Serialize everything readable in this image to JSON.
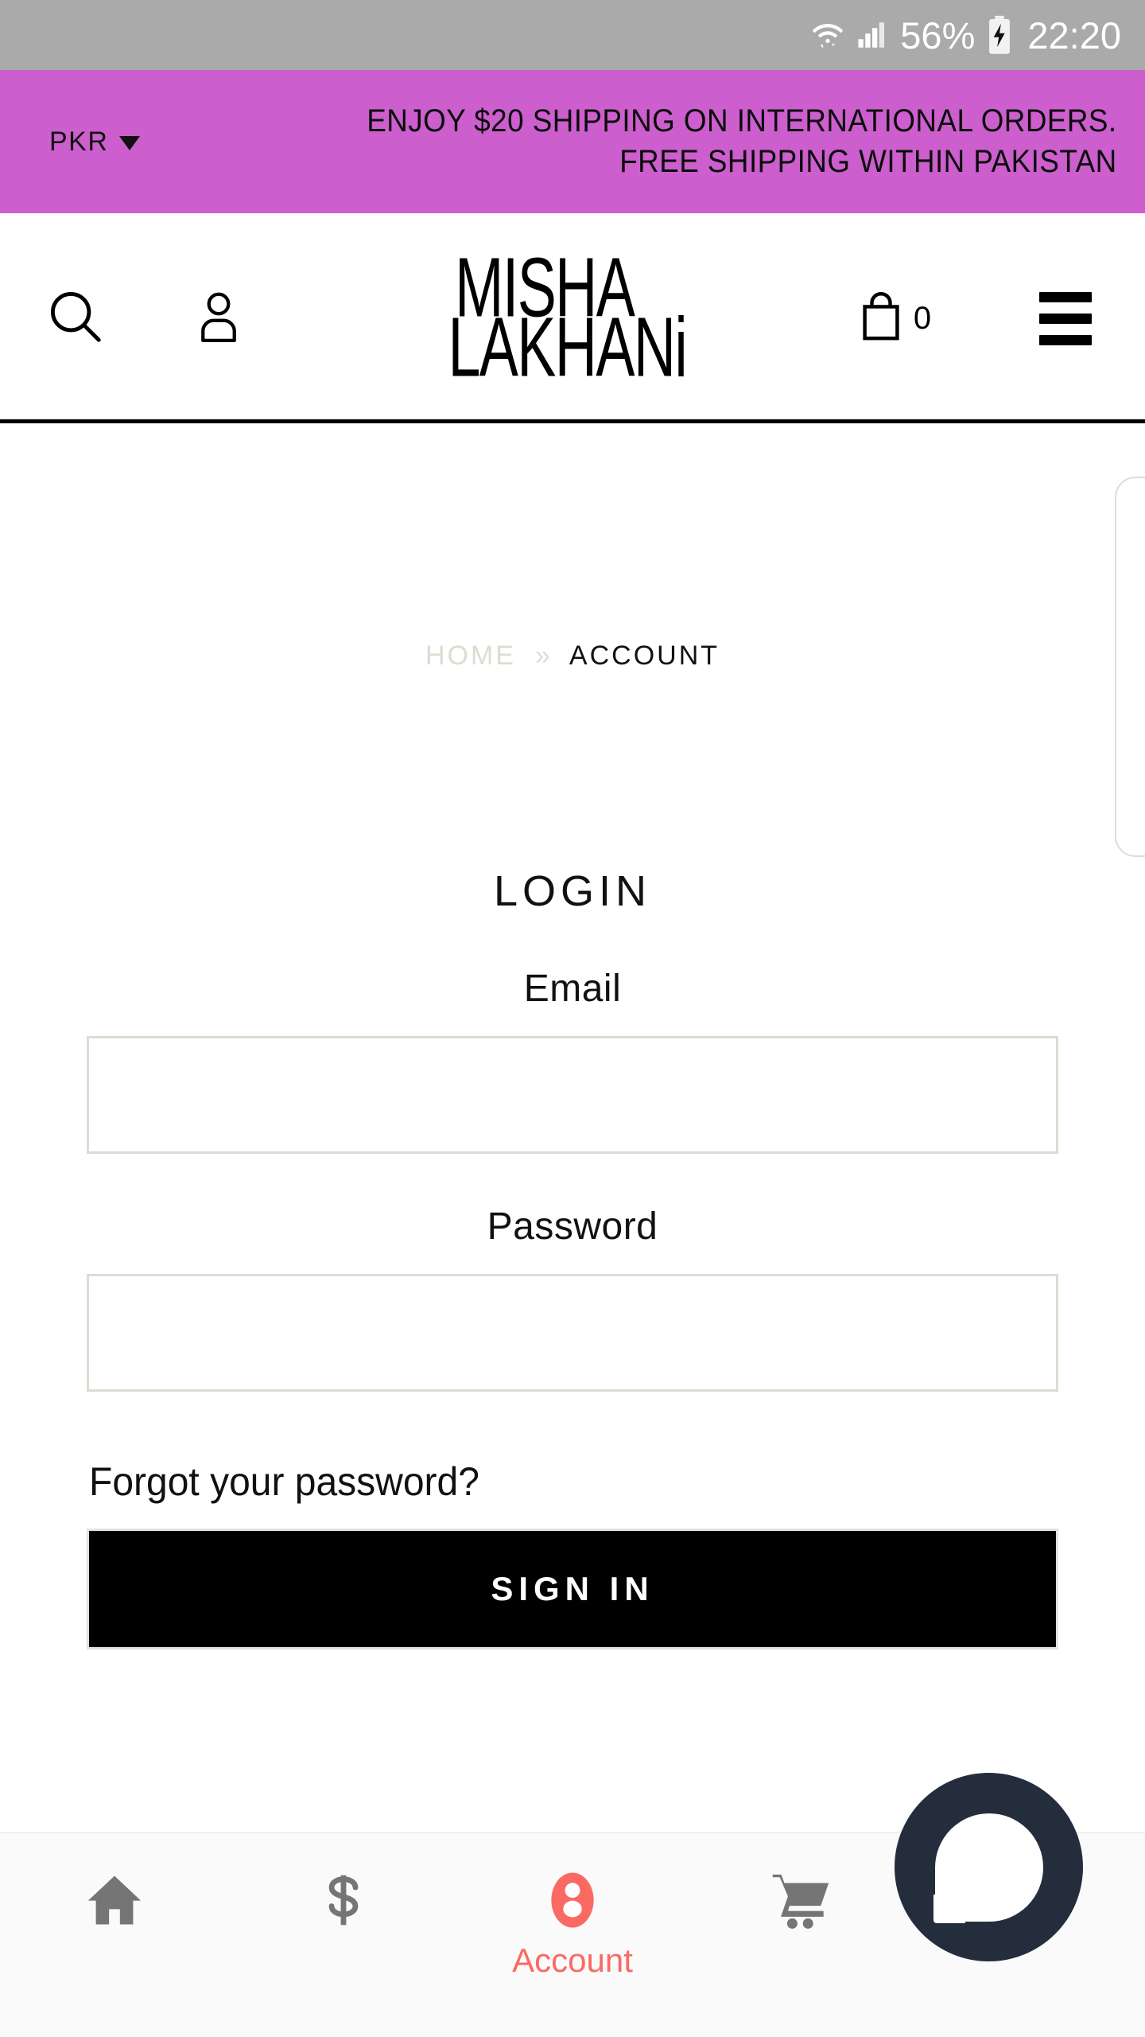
{
  "status_bar": {
    "battery_percent": "56%",
    "time": "22:20",
    "icons": [
      "wifi-icon",
      "cellular-signal-icon",
      "battery-charging-icon"
    ]
  },
  "promo_banner": {
    "currency": "PKR",
    "currency_caret": "caret-down-icon",
    "message": "ENJOY $20 SHIPPING ON INTERNATIONAL ORDERS.\nFREE SHIPPING WITHIN PAKISTAN",
    "background_color": "#cc5ecd"
  },
  "header": {
    "search_icon": "search-icon",
    "account_icon": "user-icon",
    "logo_line_1": "MISHA",
    "logo_line_2": "LAKHANi",
    "bag_icon": "shopping-bag-icon",
    "bag_count": "0",
    "menu_icon": "hamburger-menu-icon"
  },
  "breadcrumb": {
    "home": "HOME",
    "separator": "»",
    "current": "ACCOUNT"
  },
  "login_form": {
    "title": "LOGIN",
    "email_label": "Email",
    "email_value": "",
    "email_placeholder": "",
    "password_label": "Password",
    "password_value": "",
    "password_placeholder": "",
    "forgot_link": "Forgot your password?",
    "submit_label": "SIGN IN"
  },
  "chat_widget": {
    "icon": "chat-bubble-icon",
    "background_color": "#242d3c"
  },
  "bottom_nav": {
    "active_color": "#fa6a63",
    "inactive_color": "#757575",
    "items": [
      {
        "icon": "home-icon",
        "label": "",
        "active": false
      },
      {
        "icon": "dollar-icon",
        "label": "",
        "active": false
      },
      {
        "icon": "account-icon",
        "label": "Account",
        "active": true
      },
      {
        "icon": "cart-icon",
        "label": "",
        "active": false
      },
      {
        "icon": "more-vertical-icon",
        "label": "",
        "active": false
      }
    ]
  }
}
